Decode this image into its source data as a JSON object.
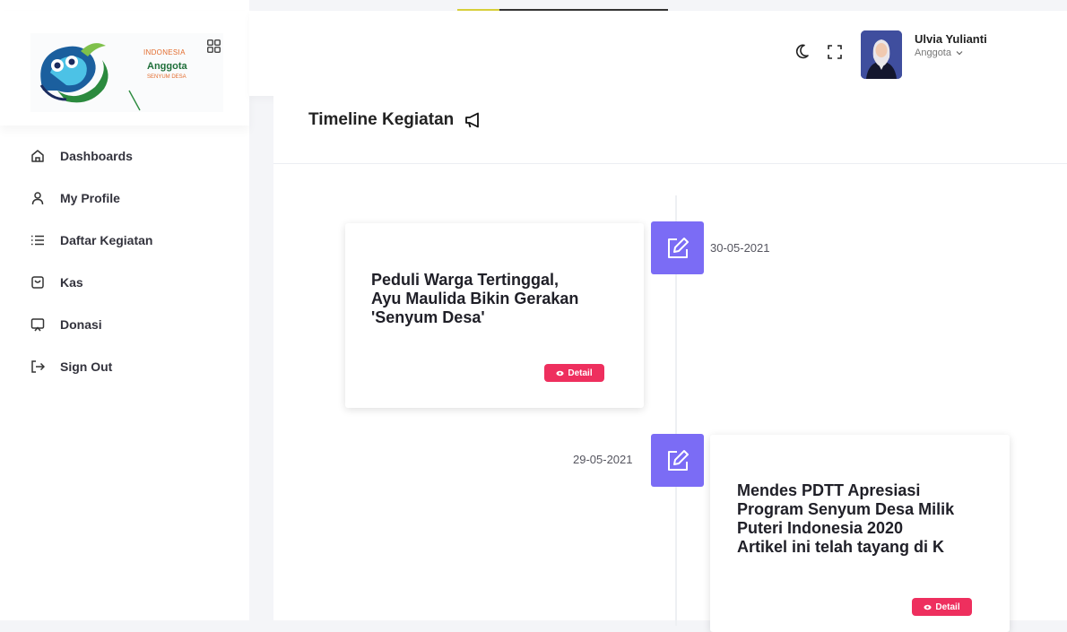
{
  "loading_progress": 0.2,
  "brand": {
    "line1": "INDONESIA",
    "line2": "Anggota",
    "line3": "SENYUM DESA",
    "grid_icon": "grid-icon"
  },
  "sidebar": {
    "items": [
      {
        "label": "Dashboards",
        "icon": "home-icon"
      },
      {
        "label": "My Profile",
        "icon": "user-icon"
      },
      {
        "label": "Daftar Kegiatan",
        "icon": "list-icon"
      },
      {
        "label": "Kas",
        "icon": "wallet-icon"
      },
      {
        "label": "Donasi",
        "icon": "donation-icon"
      },
      {
        "label": "Sign Out",
        "icon": "sign-out-icon"
      }
    ]
  },
  "header": {
    "theme_icon": "moon-icon",
    "fullscreen_icon": "fullscreen-icon",
    "user_name": "Ulvia Yulianti",
    "user_role": "Anggota"
  },
  "page": {
    "title": "Timeline Kegiatan",
    "title_icon": "megaphone-icon"
  },
  "timeline": [
    {
      "title_lines": [
        "Peduli Warga Tertinggal,",
        "Ayu Maulida Bikin Gerakan",
        "'Senyum Desa'"
      ],
      "date": "30-05-2021",
      "detail_label": "Detail",
      "badge_icon": "edit-icon"
    },
    {
      "title_lines": [
        "Mendes PDTT Apresiasi",
        "Program Senyum Desa Milik",
        "Puteri Indonesia 2020",
        "Artikel ini telah tayang di K"
      ],
      "date": "29-05-2021",
      "detail_label": "Detail",
      "badge_icon": "edit-icon"
    }
  ],
  "colors": {
    "accent": "#7b6cf5",
    "detail_button": "#ee2f5e"
  }
}
